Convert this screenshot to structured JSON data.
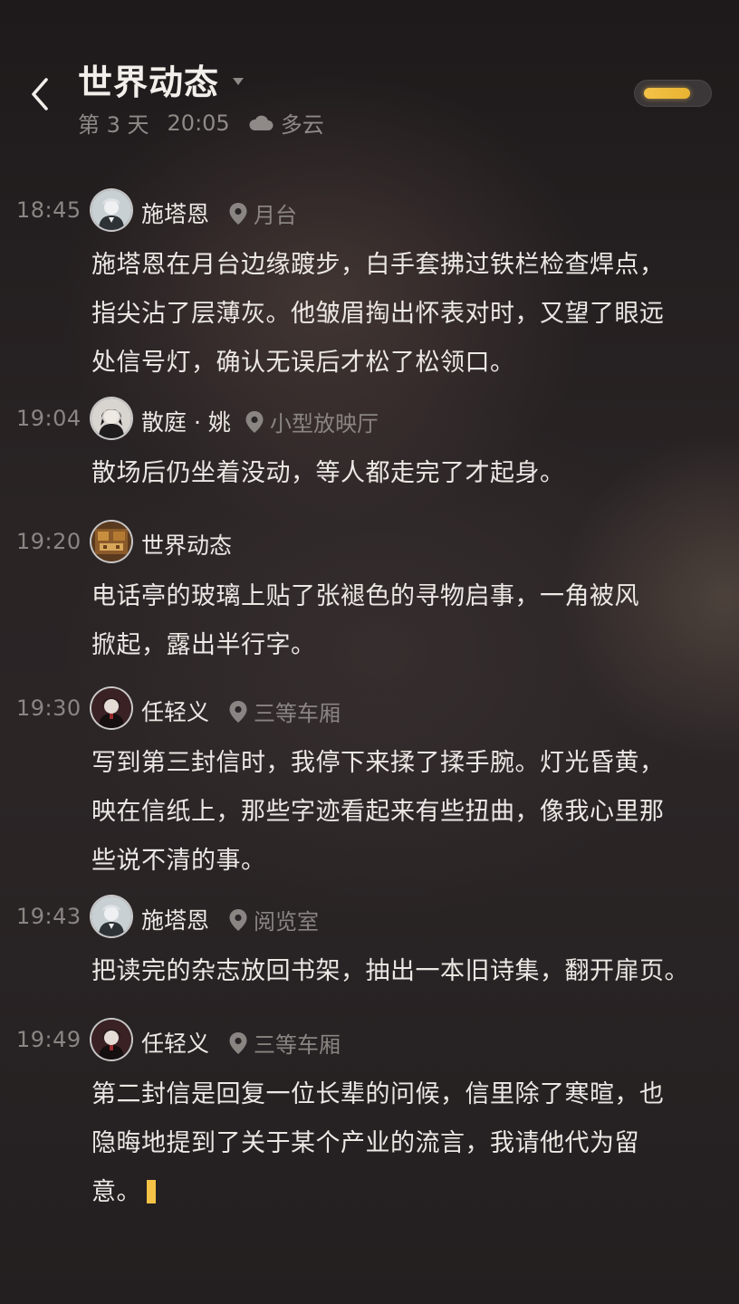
{
  "header": {
    "title": "世界动态",
    "day": "第 3 天",
    "time": "20:05",
    "weather": "多云",
    "energy_level_pct": 80
  },
  "colors": {
    "accent": "#f3c247",
    "text": "#ece8e4",
    "muted": "#8b8683",
    "background": "#221e1f"
  },
  "feed": [
    {
      "time": "18:45",
      "name": "施塔恩",
      "avatar": "avatar-shitaen",
      "location": "月台",
      "lines": [
        "施塔恩在月台边缘踱步，白手套拂过铁栏检查焊点，",
        "指尖沾了层薄灰。他皱眉掏出怀表对时，又望了眼远",
        "处信号灯，确认无误后才松了松领口。"
      ]
    },
    {
      "time": "19:04",
      "name": "散庭 · 姚",
      "avatar": "avatar-santing-yao",
      "location": "小型放映厅",
      "lines": [
        "散场后仍坐着没动，等人都走完了才起身。"
      ]
    },
    {
      "time": "19:20",
      "name": "世界动态",
      "avatar": "avatar-world",
      "location": "",
      "lines": [
        "电话亭的玻璃上贴了张褪色的寻物启事，一角被风",
        "掀起，露出半行字。"
      ]
    },
    {
      "time": "19:30",
      "name": "任轻义",
      "avatar": "avatar-renqingyi",
      "location": "三等车厢",
      "lines": [
        "写到第三封信时，我停下来揉了揉手腕。灯光昏黄，",
        "映在信纸上，那些字迹看起来有些扭曲，像我心里那",
        "些说不清的事。"
      ]
    },
    {
      "time": "19:43",
      "name": "施塔恩",
      "avatar": "avatar-shitaen",
      "location": "阅览室",
      "lines": [
        "把读完的杂志放回书架，抽出一本旧诗集，翻开扉页。"
      ]
    },
    {
      "time": "19:49",
      "name": "任轻义",
      "avatar": "avatar-renqingyi",
      "location": "三等车厢",
      "lines": [
        "第二封信是回复一位长辈的问候，信里除了寒暄，也",
        "隐晦地提到了关于某个产业的流言，我请他代为留",
        "意。"
      ]
    }
  ]
}
